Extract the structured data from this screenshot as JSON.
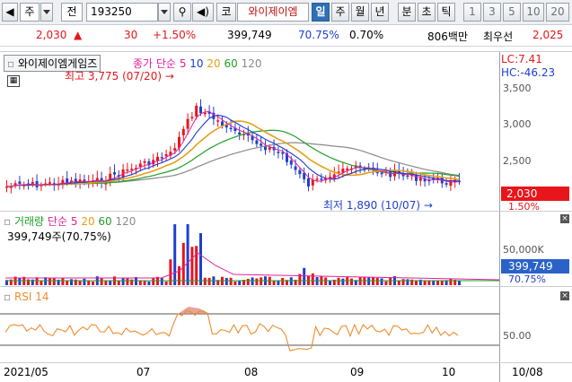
{
  "toolbar": {
    "type_label": "주",
    "period_label": "전",
    "code_value": "193250",
    "name_button": "코",
    "stock_name": "와이제이엠",
    "periods": [
      "일",
      "주",
      "월",
      "년",
      "분",
      "초",
      "틱"
    ],
    "numbers": [
      "1",
      "3",
      "5",
      "10",
      "20"
    ]
  },
  "info": {
    "price": "2,030",
    "change": "30",
    "change_pct": "+1.50%",
    "volume": "399,749",
    "vol_ratio": "70.75%",
    "turnover": "0.70%",
    "amount": "806백만",
    "best_ask_label": "최우선",
    "best_ask": "2,025"
  },
  "price_panel": {
    "name": "와이제이엠게임즈",
    "ma_label": "종가 단순",
    "ma_periods": [
      "5",
      "10",
      "20",
      "60",
      "120"
    ],
    "high_label": "최고 3,775 (07/20)",
    "low_label": "최저 1,890 (10/07)",
    "lc": "LC:7.41",
    "hc": "HC:-46.23",
    "y_ticks": [
      "3,500",
      "3,000",
      "2,500"
    ],
    "price_tag": "2,030",
    "pct_tag": "1.50%"
  },
  "volume_panel": {
    "title": "거래량",
    "ma_label": "단순",
    "ma_periods": [
      "5",
      "20",
      "60",
      "120"
    ],
    "value_label": "399,749주(70.75%)",
    "y_tick": "50,000K",
    "value_tag": "399,749",
    "pct_tag": "70.75%"
  },
  "rsi_panel": {
    "title": "RSI 14",
    "y_tick": "50.00"
  },
  "x_axis": {
    "labels": [
      "2021/05",
      "07",
      "08",
      "09",
      "10"
    ],
    "right_label": "10/08"
  },
  "colors": {
    "up": "#e8151b",
    "down": "#1f3fd1",
    "ma5": "#e0209a",
    "ma10": "#1a3ad1",
    "ma20": "#e6a017",
    "ma60": "#1f9f2a",
    "ma120": "#8a8a8a",
    "rsi": "#f08c2e",
    "tag": "#e8151b",
    "vtag": "#2a62c9"
  }
}
